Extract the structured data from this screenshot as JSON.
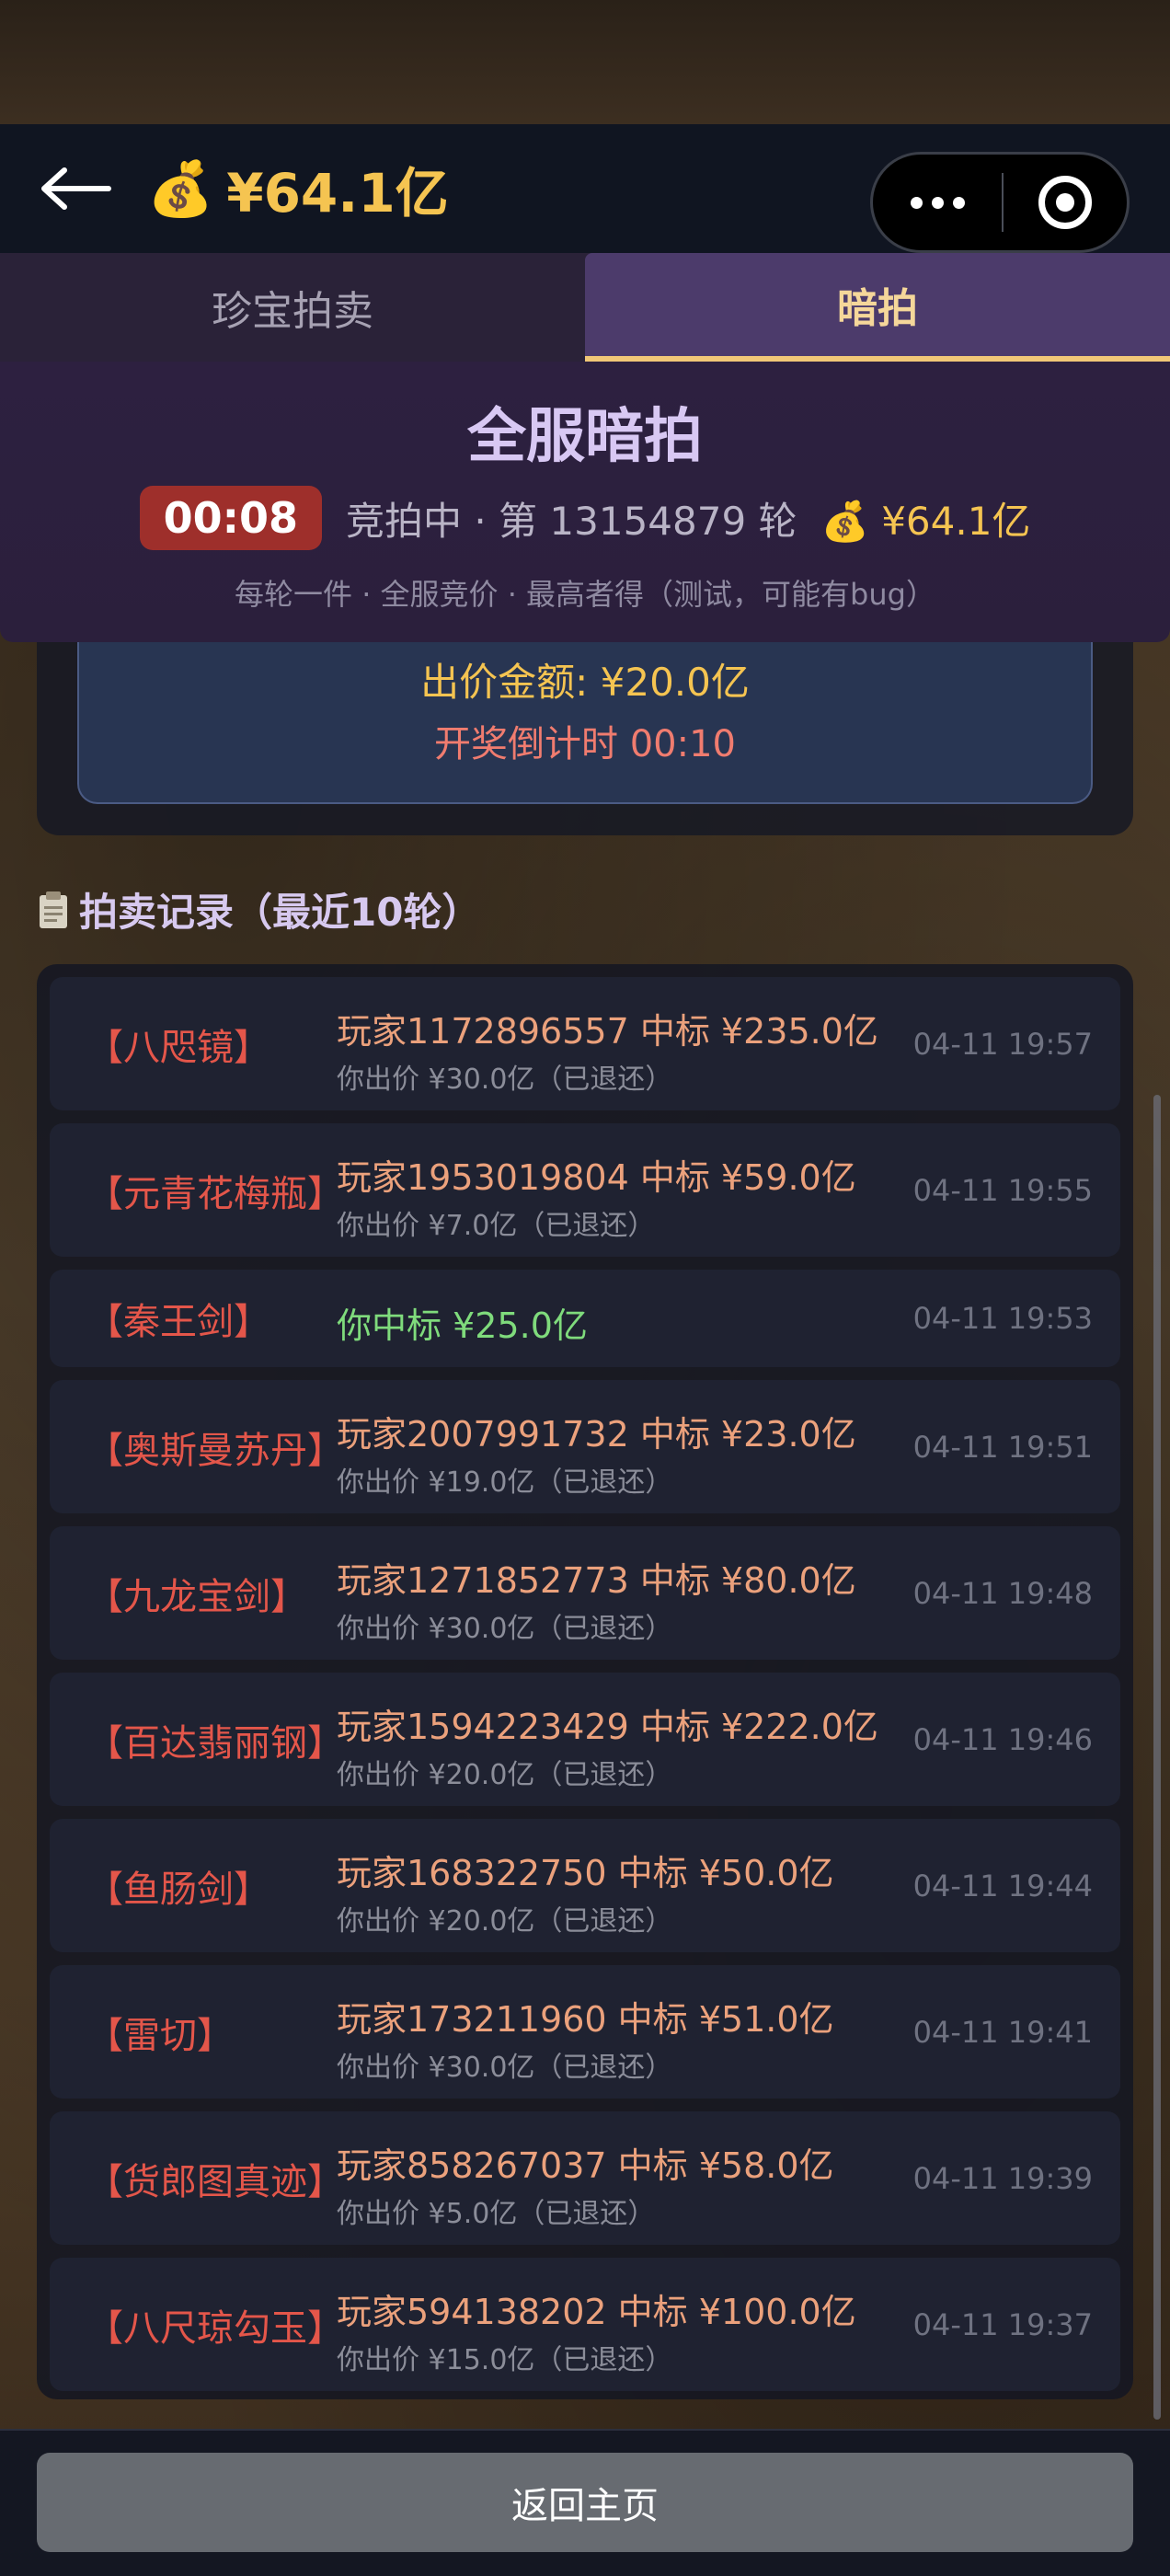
{
  "header": {
    "back_icon": "arrow-left-icon",
    "money_icon": "money-bag-icon",
    "balance": "¥64.1亿",
    "more_icon": "more-dots-icon",
    "target_icon": "target-icon"
  },
  "tabs": [
    {
      "label": "珍宝拍卖",
      "active": false
    },
    {
      "label": "暗拍",
      "active": true
    }
  ],
  "auction": {
    "title": "全服暗拍",
    "timer": "00:08",
    "status": "竞拍中 · 第 13154879 轮",
    "balance": "¥64.1亿",
    "note": "每轮一件 · 全服竞价 · 最高者得（测试，可能有bug）"
  },
  "bid": {
    "amount": "出价金额: ¥20.0亿",
    "countdown": "开奖倒计时 00:10"
  },
  "records_title": "拍卖记录（最近10轮）",
  "records": [
    {
      "item": "【八咫镜】",
      "line1": "玩家1172896557 中标 ¥235.0亿",
      "line2": "你出价 ¥30.0亿（已退还）",
      "time": "04-11 19:57"
    },
    {
      "item": "【元青花梅瓶】",
      "line1": "玩家1953019804 中标 ¥59.0亿",
      "line2": "你出价 ¥7.0亿（已退还）",
      "time": "04-11 19:55"
    },
    {
      "item": "【秦王剑】",
      "line1": "你中标 ¥25.0亿",
      "line2": "",
      "time": "04-11 19:53"
    },
    {
      "item": "【奥斯曼苏丹】",
      "line1": "玩家2007991732 中标 ¥23.0亿",
      "line2": "你出价 ¥19.0亿（已退还）",
      "time": "04-11 19:51"
    },
    {
      "item": "【九龙宝剑】",
      "line1": "玩家1271852773 中标 ¥80.0亿",
      "line2": "你出价 ¥30.0亿（已退还）",
      "time": "04-11 19:48"
    },
    {
      "item": "【百达翡丽钢】",
      "line1": "玩家1594223429 中标 ¥222.0亿",
      "line2": "你出价 ¥20.0亿（已退还）",
      "time": "04-11 19:46"
    },
    {
      "item": "【鱼肠剑】",
      "line1": "玩家168322750 中标 ¥50.0亿",
      "line2": "你出价 ¥20.0亿（已退还）",
      "time": "04-11 19:44"
    },
    {
      "item": "【雷切】",
      "line1": "玩家173211960 中标 ¥51.0亿",
      "line2": "你出价 ¥30.0亿（已退还）",
      "time": "04-11 19:41"
    },
    {
      "item": "【货郎图真迹】",
      "line1": "玩家858267037 中标 ¥58.0亿",
      "line2": "你出价 ¥5.0亿（已退还）",
      "time": "04-11 19:39"
    },
    {
      "item": "【八尺琼勾玉】",
      "line1": "玩家594138202 中标 ¥100.0亿",
      "line2": "你出价 ¥15.0亿（已退还）",
      "time": "04-11 19:37"
    }
  ],
  "footer": {
    "home_label": "返回主页"
  }
}
